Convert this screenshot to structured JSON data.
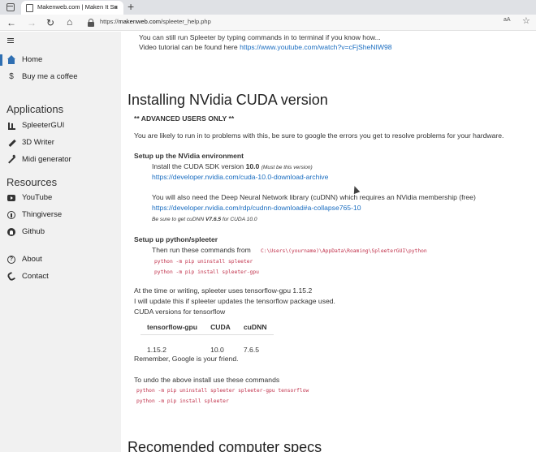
{
  "browser": {
    "tab_title": "Makenweb.com | Maken It So",
    "tab_close": "×",
    "new_tab": "+",
    "url_prefix": "https://",
    "url_domain": "makenweb.com",
    "url_path": "/spleeter_help.php",
    "reader_label": "aA",
    "favorite_icon": "star-plus-icon"
  },
  "sidebar": {
    "top_items": [
      {
        "label": "Home",
        "icon": "home-icon",
        "active": true
      },
      {
        "label": "Buy me a coffee",
        "icon": "dollar-icon"
      }
    ],
    "applications_heading": "Applications",
    "applications": [
      {
        "label": "SpleeterGUI",
        "icon": "bar-chart-icon"
      },
      {
        "label": "3D Writer",
        "icon": "pencil-icon"
      },
      {
        "label": "Midi generator",
        "icon": "magic-wand-icon"
      }
    ],
    "resources_heading": "Resources",
    "resources": [
      {
        "label": "YouTube",
        "icon": "youtube-icon"
      },
      {
        "label": "Thingiverse",
        "icon": "thingiverse-icon"
      },
      {
        "label": "Github",
        "icon": "github-icon"
      }
    ],
    "bottom_items": [
      {
        "label": "About",
        "icon": "question-icon"
      },
      {
        "label": "Contact",
        "icon": "phone-icon"
      }
    ]
  },
  "content": {
    "intro_line1": "You can still run Spleeter by typing commands in to terminal if you know how...",
    "intro_line2_prefix": "Video tutorial can be found here ",
    "intro_video_link": "https://www.youtube.com/watch?v=cFjSheNIW98",
    "cuda_heading": "Installing NVidia CUDA version",
    "advanced_note": "** ADVANCED USERS ONLY **",
    "warning": "You are likely to run in to problems with this, be sure to google the errors you get to resolve problems for your hardware.",
    "env_heading": "Setup up the NVidia environment",
    "sdk_prefix": "Install the CUDA SDK version ",
    "sdk_version": "10.0",
    "sdk_note": "(Must be this version)",
    "sdk_link": "https://developer.nvidia.com/cuda-10.0-download-archive",
    "cudnn_text": "You will also need the Deep Neural Network library (cuDNN) which requires an NVidia membership (free)",
    "cudnn_link": "https://developer.nvidia.com/rdp/cudnn-download#a-collapse765-10",
    "cudnn_note_prefix": "Be sure to get cuDNN ",
    "cudnn_note_version": "V7.6.5",
    "cudnn_note_suffix": " for CUDA 10.0",
    "python_heading": "Setup up python/spleeter",
    "run_commands_prefix": "Then run these commands from ",
    "run_commands_path": "C:\\Users\\(yourname)\\AppData\\Roaming\\SpleeterGUI\\python",
    "cmd1": "python -m pip uninstall spleeter",
    "cmd2": "python -m pip install spleeter-gpu",
    "tf_line1": "At the time or writing, spleeter uses tensorflow-gpu 1.15.2",
    "tf_line2": "I will update this if spleeter updates the tensorflow package used.",
    "tf_line3": "CUDA versions for tensorflow",
    "table": {
      "headers": [
        "tensorflow-gpu",
        "CUDA",
        "cuDNN"
      ],
      "rows": [
        [
          "1.15.2",
          "10.0",
          "7.6.5"
        ]
      ]
    },
    "remember": "Remember, Google is your friend.",
    "undo_text": "To undo the above install use these commands",
    "undo_cmd1": "python -m pip uninstall spleeter spleeter-gpu tensorflow",
    "undo_cmd2": "python -m pip install spleeter",
    "specs_heading": "Recomended computer specs"
  }
}
